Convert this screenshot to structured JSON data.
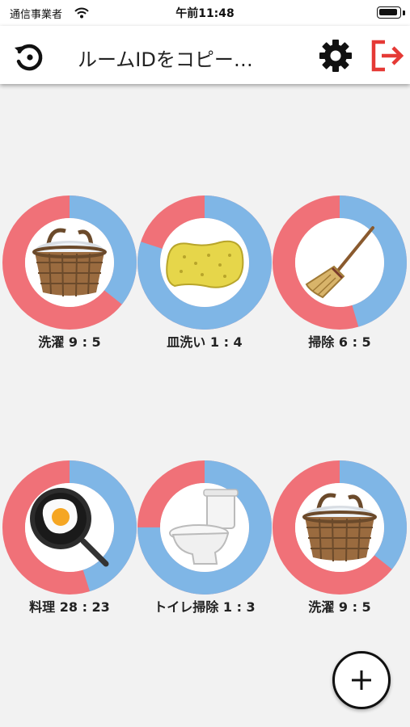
{
  "status_bar": {
    "carrier": "通信事業者",
    "time": "午前11:48"
  },
  "app_bar": {
    "title": "ルームIDをコピー…",
    "history_icon": "history-icon",
    "settings_icon": "gear-icon",
    "logout_icon": "logout-icon"
  },
  "colors": {
    "red": "#f07178",
    "blue": "#7fb6e6",
    "logout": "#e53935"
  },
  "chores": [
    {
      "name": "洗濯",
      "label": "洗濯 9 : 5",
      "score_a": 9,
      "score_b": 5,
      "icon": "laundry-basket-icon"
    },
    {
      "name": "皿洗い",
      "label": "皿洗い 1 : 4",
      "score_a": 1,
      "score_b": 4,
      "icon": "sponge-icon"
    },
    {
      "name": "掃除",
      "label": "掃除 6 : 5",
      "score_a": 6,
      "score_b": 5,
      "icon": "broom-icon"
    },
    {
      "name": "料理",
      "label": "料理 28 : 23",
      "score_a": 28,
      "score_b": 23,
      "icon": "frying-pan-icon"
    },
    {
      "name": "トイレ掃除",
      "label": "トイレ掃除 1 : 3",
      "score_a": 1,
      "score_b": 3,
      "icon": "toilet-icon"
    },
    {
      "name": "洗濯",
      "label": "洗濯 9 : 5",
      "score_a": 9,
      "score_b": 5,
      "icon": "laundry-basket-icon"
    }
  ],
  "add_button": {
    "icon": "plus-icon"
  }
}
